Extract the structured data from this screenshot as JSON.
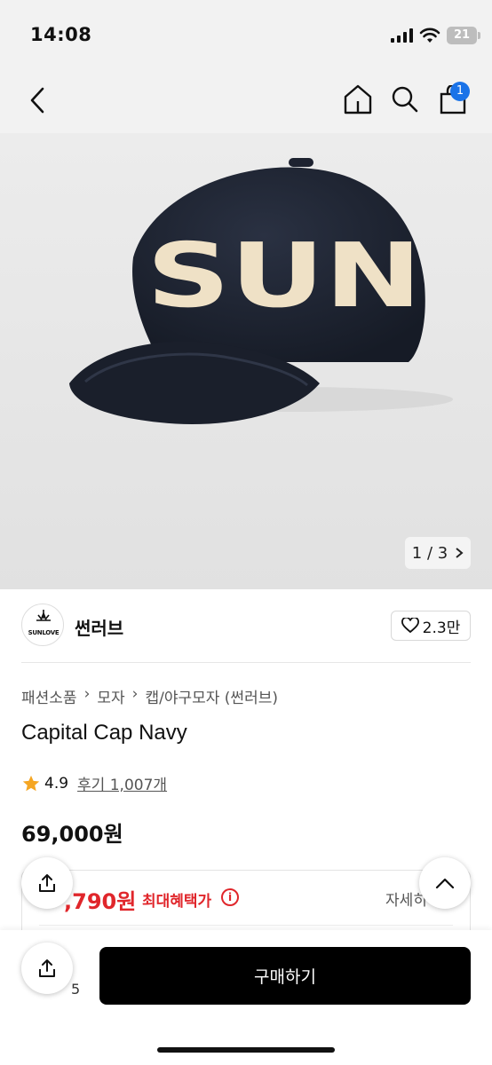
{
  "status_bar": {
    "time": "14:08",
    "battery": "21"
  },
  "nav": {
    "cart_count": "1"
  },
  "hero": {
    "cap_letters": "SUN",
    "image_counter": "1 / 3"
  },
  "brand": {
    "logo_text": "SUNLOVE",
    "name": "썬러브",
    "likes": "2.3만"
  },
  "product": {
    "breadcrumb": [
      "패션소품",
      "모자",
      "캡/야구모자 (썬러브)"
    ],
    "title": "Capital Cap Navy",
    "rating": "4.9",
    "reviews": "후기 1,007개",
    "price": "69,000원"
  },
  "benefit": {
    "price": ",790원",
    "label": "최대혜택가",
    "info_icon": "i",
    "detail_link": "자세히"
  },
  "bottom_bar": {
    "partial_value": "5",
    "buy_label": "구매하기"
  },
  "colors": {
    "accent_red": "#e0262b",
    "badge_blue": "#1a73e8",
    "cap_navy": "#1f2533",
    "cap_letter": "#efe1c6"
  },
  "icons": [
    "back-icon",
    "home-icon",
    "search-icon",
    "cart-icon",
    "heart-icon",
    "star-icon",
    "share-icon",
    "chevron-up-icon",
    "chevron-right-icon",
    "info-icon"
  ]
}
